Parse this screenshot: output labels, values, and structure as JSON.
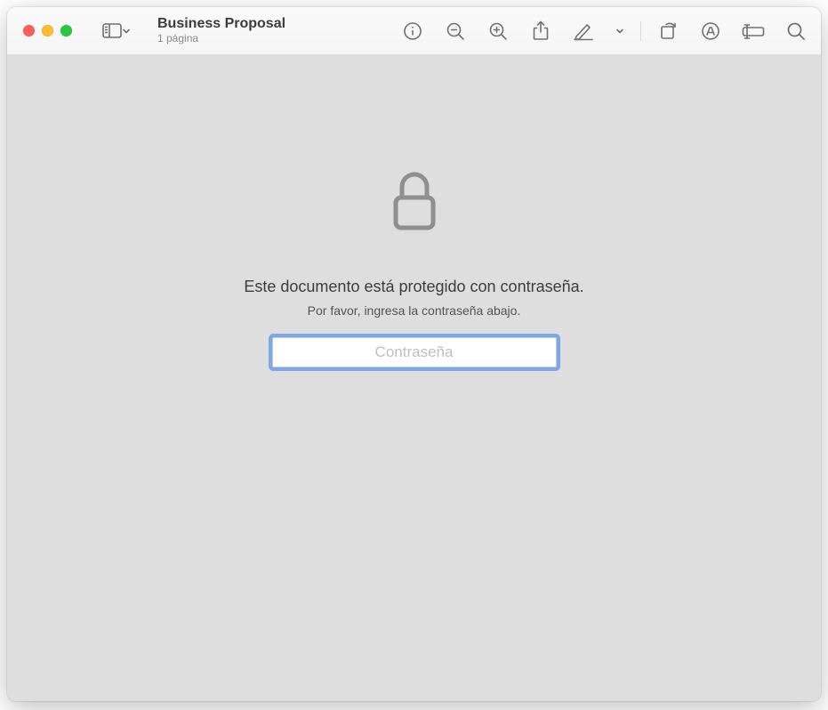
{
  "window": {
    "title": "Business Proposal",
    "subtitle": "1 página"
  },
  "locked": {
    "headline": "Este documento está protegido con contraseña.",
    "subtext": "Por favor, ingresa la contraseña abajo.",
    "placeholder": "Contraseña"
  }
}
